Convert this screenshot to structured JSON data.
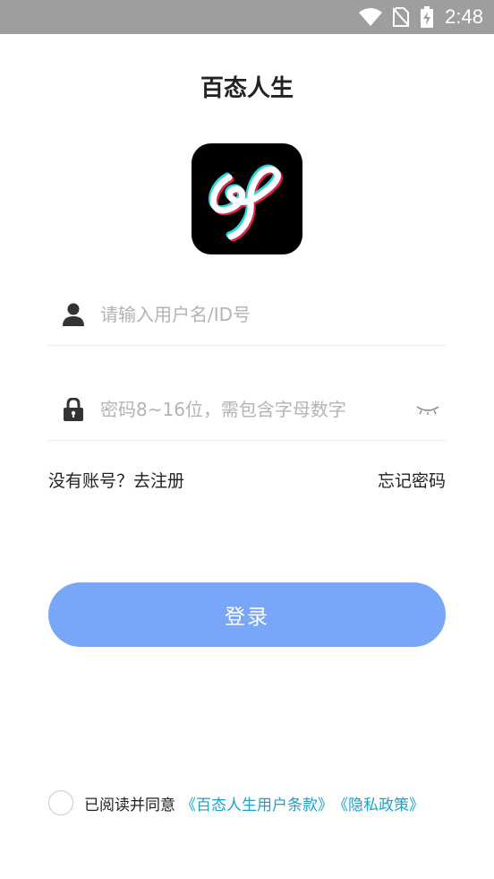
{
  "status_bar": {
    "time": "2:48"
  },
  "app": {
    "title": "百态人生"
  },
  "form": {
    "username_placeholder": "请输入用户名/ID号",
    "password_placeholder": "密码8~16位，需包含字母数字",
    "register_link": "没有账号？去注册",
    "forgot_link": "忘记密码",
    "login_button": "登录"
  },
  "agreement": {
    "text": "已阅读并同意",
    "terms_link": "《百态人生用户条款》",
    "privacy_link": "《隐私政策》"
  },
  "colors": {
    "status_bar": "#9e9e9e",
    "button": "#79a6f8",
    "link": "#1aa3c9"
  }
}
